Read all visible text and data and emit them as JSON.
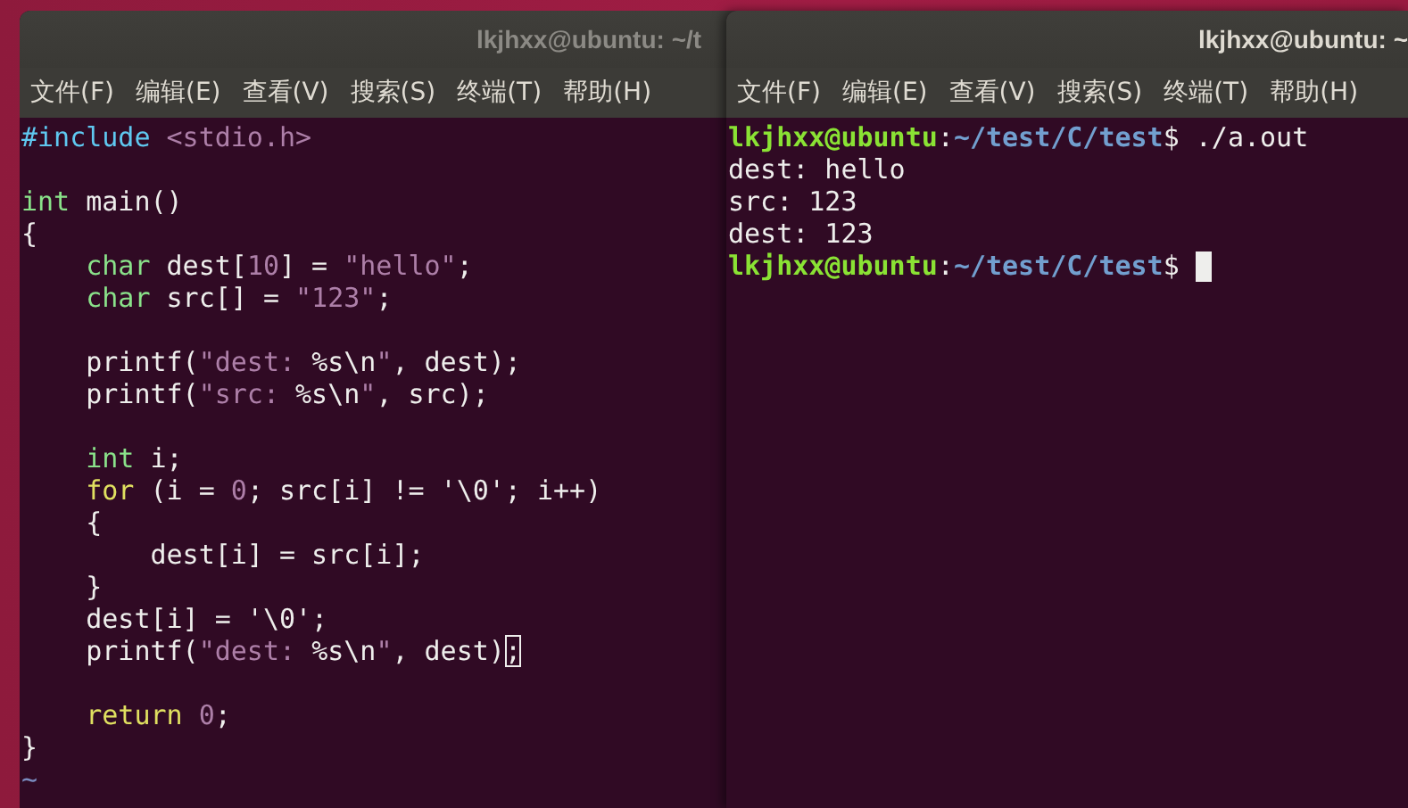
{
  "windows": [
    {
      "title": "lkjhxx@ubuntu: ~/t",
      "active": false,
      "menu": [
        "文件(F)",
        "编辑(E)",
        "查看(V)",
        "搜索(S)",
        "终端(T)",
        "帮助(H)"
      ],
      "lines": [
        {
          "kind": "code",
          "segments": [
            {
              "kind": "preproc",
              "text": "#include"
            },
            {
              "kind": "string",
              "text": " <stdio.h>"
            }
          ]
        },
        {
          "kind": "blank"
        },
        {
          "kind": "code",
          "segments": [
            {
              "kind": "type",
              "text": "int"
            },
            {
              "kind": "plain",
              "text": " main()"
            }
          ]
        },
        {
          "kind": "code",
          "segments": [
            {
              "kind": "plain",
              "text": "{"
            }
          ]
        },
        {
          "kind": "code",
          "segments": [
            {
              "kind": "type",
              "text": "    char"
            },
            {
              "kind": "plain",
              "text": " dest["
            },
            {
              "kind": "string",
              "text": "10"
            },
            {
              "kind": "plain",
              "text": "] = "
            },
            {
              "kind": "string",
              "text": "\"hello\""
            },
            {
              "kind": "plain",
              "text": ";"
            }
          ]
        },
        {
          "kind": "code",
          "segments": [
            {
              "kind": "type",
              "text": "    char"
            },
            {
              "kind": "plain",
              "text": " src[] = "
            },
            {
              "kind": "string",
              "text": "\"123\""
            },
            {
              "kind": "plain",
              "text": ";"
            }
          ]
        },
        {
          "kind": "blank"
        },
        {
          "kind": "code",
          "segments": [
            {
              "kind": "plain",
              "text": "    printf("
            },
            {
              "kind": "string",
              "text": "\"dest: "
            },
            {
              "kind": "plain",
              "text": "%s\\n"
            },
            {
              "kind": "string",
              "text": "\""
            },
            {
              "kind": "plain",
              "text": ", dest);"
            }
          ]
        },
        {
          "kind": "code",
          "segments": [
            {
              "kind": "plain",
              "text": "    printf("
            },
            {
              "kind": "string",
              "text": "\"src: "
            },
            {
              "kind": "plain",
              "text": "%s\\n"
            },
            {
              "kind": "string",
              "text": "\""
            },
            {
              "kind": "plain",
              "text": ", src);"
            }
          ]
        },
        {
          "kind": "blank"
        },
        {
          "kind": "code",
          "segments": [
            {
              "kind": "type",
              "text": "    int"
            },
            {
              "kind": "plain",
              "text": " i;"
            }
          ]
        },
        {
          "kind": "code",
          "segments": [
            {
              "kind": "keyword",
              "text": "    for"
            },
            {
              "kind": "plain",
              "text": " (i = "
            },
            {
              "kind": "string",
              "text": "0"
            },
            {
              "kind": "plain",
              "text": "; src[i] != '\\0'; i++)"
            }
          ]
        },
        {
          "kind": "code",
          "segments": [
            {
              "kind": "plain",
              "text": "    {"
            }
          ]
        },
        {
          "kind": "code",
          "segments": [
            {
              "kind": "plain",
              "text": "        dest[i] = src[i];"
            }
          ]
        },
        {
          "kind": "code",
          "segments": [
            {
              "kind": "plain",
              "text": "    }"
            }
          ]
        },
        {
          "kind": "code",
          "segments": [
            {
              "kind": "plain",
              "text": "    dest[i] = '\\0';"
            }
          ]
        },
        {
          "kind": "code",
          "segments": [
            {
              "kind": "plain",
              "text": "    printf("
            },
            {
              "kind": "string",
              "text": "\"dest: "
            },
            {
              "kind": "plain",
              "text": "%s\\n"
            },
            {
              "kind": "string",
              "text": "\""
            },
            {
              "kind": "plain",
              "text": ", dest)"
            },
            {
              "kind": "cursor",
              "text": ";"
            }
          ]
        },
        {
          "kind": "blank"
        },
        {
          "kind": "code",
          "segments": [
            {
              "kind": "keyword",
              "text": "    return"
            },
            {
              "kind": "string",
              "text": " 0"
            },
            {
              "kind": "plain",
              "text": ";"
            }
          ]
        },
        {
          "kind": "code",
          "segments": [
            {
              "kind": "plain",
              "text": "}"
            }
          ]
        },
        {
          "kind": "filler",
          "text": "~"
        }
      ]
    },
    {
      "title": "lkjhxx@ubuntu: ~",
      "active": true,
      "menu": [
        "文件(F)",
        "编辑(E)",
        "查看(V)",
        "搜索(S)",
        "终端(T)",
        "帮助(H)"
      ],
      "lines": [
        {
          "kind": "code",
          "segments": [
            {
              "kind": "user",
              "text": "lkjhxx@ubuntu"
            },
            {
              "kind": "plain",
              "text": ":"
            },
            {
              "kind": "path",
              "text": "~/test/C/test"
            },
            {
              "kind": "plain",
              "text": "$ ./a.out"
            }
          ]
        },
        {
          "kind": "code",
          "segments": [
            {
              "kind": "plain",
              "text": "dest: hello"
            }
          ]
        },
        {
          "kind": "code",
          "segments": [
            {
              "kind": "plain",
              "text": "src: 123"
            }
          ]
        },
        {
          "kind": "code",
          "segments": [
            {
              "kind": "plain",
              "text": "dest: 123"
            }
          ]
        },
        {
          "kind": "code",
          "cursor": true,
          "segments": [
            {
              "kind": "user",
              "text": "lkjhxx@ubuntu"
            },
            {
              "kind": "plain",
              "text": ":"
            },
            {
              "kind": "path",
              "text": "~/test/C/test"
            },
            {
              "kind": "plain",
              "text": "$ "
            }
          ]
        }
      ]
    }
  ]
}
